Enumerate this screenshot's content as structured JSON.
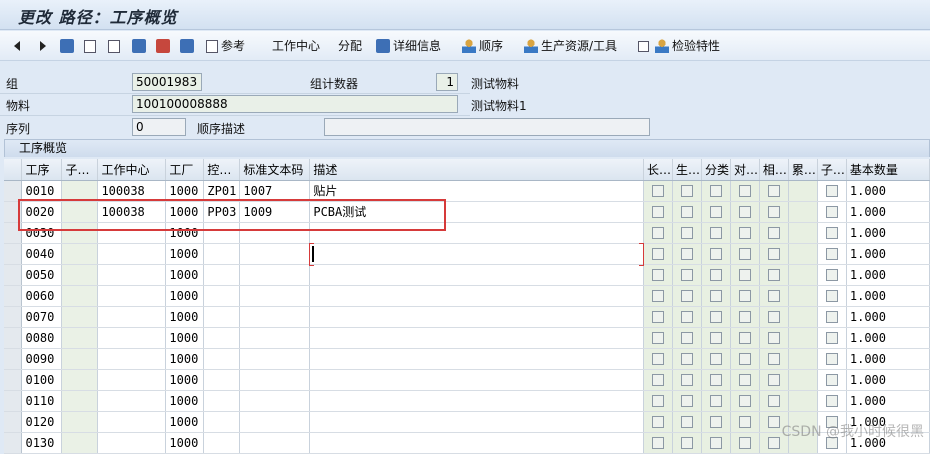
{
  "title": "更改 路径：工序概览",
  "toolbar": {
    "ref_label": "参考",
    "work_center_label": "工作中心",
    "assign_label": "分配",
    "detail_label": "详细信息",
    "sequence_label": "顺序",
    "prt_label": "生产资源/工具",
    "inspection_label": "检验特性"
  },
  "header": {
    "group_label": "组",
    "group_value": "50001983",
    "group_counter_label": "组计数器",
    "group_counter_value": "1",
    "group_desc": "测试物料",
    "material_label": "物料",
    "material_value": "100100008888",
    "material_desc": "测试物料1",
    "sequence_label": "序列",
    "sequence_value": "0",
    "sequence_desc_label": "顺序描述",
    "sequence_desc_value": ""
  },
  "grid": {
    "title": "工序概览",
    "columns": [
      "工序",
      "子…",
      "工作中心",
      "工厂",
      "控…",
      "标准文本码",
      "描述",
      "长…",
      "生…",
      "分类",
      "对…",
      "相…",
      "累…",
      "子…",
      "基本数量"
    ],
    "rows": [
      {
        "op": "0010",
        "sub": "",
        "wc": "100038",
        "plant": "1000",
        "ctrl": "ZP01",
        "std": "1007",
        "desc": "贴片",
        "qty": "1.000"
      },
      {
        "op": "0020",
        "sub": "",
        "wc": "100038",
        "plant": "1000",
        "ctrl": "PP03",
        "std": "1009",
        "desc": "PCBA测试",
        "qty": "1.000"
      },
      {
        "op": "0030",
        "sub": "",
        "wc": "",
        "plant": "1000",
        "ctrl": "",
        "std": "",
        "desc": "",
        "qty": "1.000"
      },
      {
        "op": "0040",
        "sub": "",
        "wc": "",
        "plant": "1000",
        "ctrl": "",
        "std": "",
        "desc": "",
        "qty": "1.000"
      },
      {
        "op": "0050",
        "sub": "",
        "wc": "",
        "plant": "1000",
        "ctrl": "",
        "std": "",
        "desc": "",
        "qty": "1.000"
      },
      {
        "op": "0060",
        "sub": "",
        "wc": "",
        "plant": "1000",
        "ctrl": "",
        "std": "",
        "desc": "",
        "qty": "1.000"
      },
      {
        "op": "0070",
        "sub": "",
        "wc": "",
        "plant": "1000",
        "ctrl": "",
        "std": "",
        "desc": "",
        "qty": "1.000"
      },
      {
        "op": "0080",
        "sub": "",
        "wc": "",
        "plant": "1000",
        "ctrl": "",
        "std": "",
        "desc": "",
        "qty": "1.000"
      },
      {
        "op": "0090",
        "sub": "",
        "wc": "",
        "plant": "1000",
        "ctrl": "",
        "std": "",
        "desc": "",
        "qty": "1.000"
      },
      {
        "op": "0100",
        "sub": "",
        "wc": "",
        "plant": "1000",
        "ctrl": "",
        "std": "",
        "desc": "",
        "qty": "1.000"
      },
      {
        "op": "0110",
        "sub": "",
        "wc": "",
        "plant": "1000",
        "ctrl": "",
        "std": "",
        "desc": "",
        "qty": "1.000"
      },
      {
        "op": "0120",
        "sub": "",
        "wc": "",
        "plant": "1000",
        "ctrl": "",
        "std": "",
        "desc": "",
        "qty": "1.000"
      },
      {
        "op": "0130",
        "sub": "",
        "wc": "",
        "plant": "1000",
        "ctrl": "",
        "std": "",
        "desc": "",
        "qty": "1.000"
      }
    ]
  },
  "watermark": "CSDN @我小时候很黑",
  "colors": {
    "highlight": "#d63a3a",
    "background": "#dfe9f5"
  }
}
